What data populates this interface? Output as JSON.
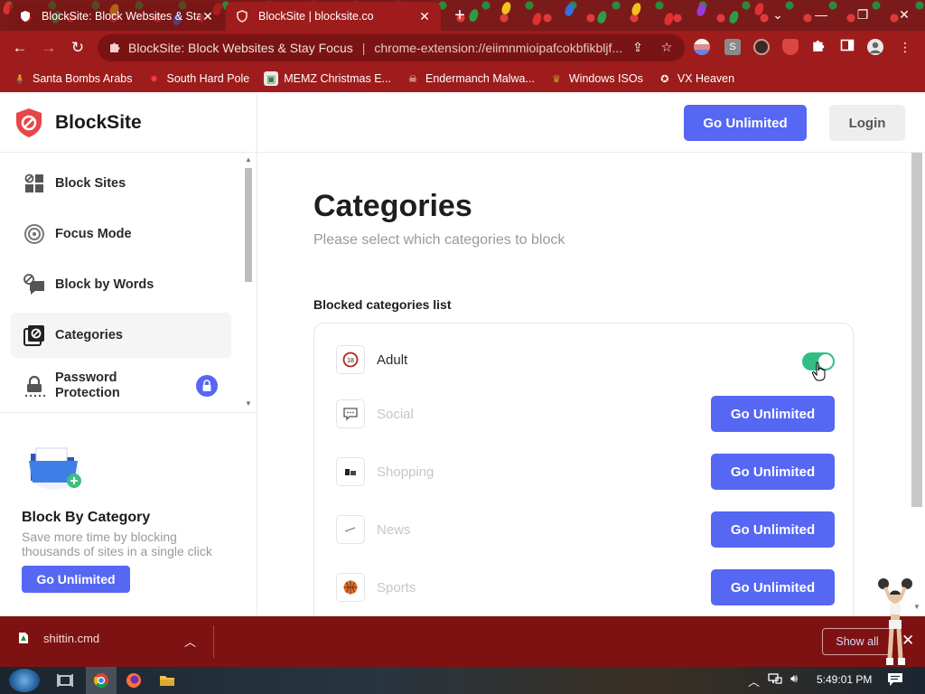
{
  "browser": {
    "tabs": [
      {
        "label": "BlockSite: Block Websites & Stay",
        "active": false
      },
      {
        "label": "BlockSite | blocksite.co",
        "active": true
      }
    ],
    "new_tab": "+",
    "window_controls": {
      "dropdown": "⌄",
      "minimize": "—",
      "restore": "❐",
      "close": "✕"
    },
    "omnibox": {
      "page_name": "BlockSite: Block Websites & Stay Focus",
      "separator": "|",
      "url": "chrome-extension://eiimnmioipafcokbfikbljf..."
    },
    "bookmarks": [
      {
        "label": "Santa Bombs Arabs",
        "icon": "person-icon"
      },
      {
        "label": "South Hard Pole",
        "icon": "maple-leaf-icon"
      },
      {
        "label": "MEMZ Christmas E...",
        "icon": "image-icon"
      },
      {
        "label": "Endermanch Malwa...",
        "icon": "skull-icon"
      },
      {
        "label": "Windows ISOs",
        "icon": "trophy-icon"
      },
      {
        "label": "VX Heaven",
        "icon": "badge-icon"
      }
    ]
  },
  "app": {
    "brand": "BlockSite",
    "header": {
      "go_unlimited": "Go Unlimited",
      "login": "Login"
    },
    "nav": [
      {
        "label": "Block Sites",
        "icon": "grid-icon",
        "active": false
      },
      {
        "label": "Focus Mode",
        "icon": "target-icon",
        "active": false
      },
      {
        "label": "Block by Words",
        "icon": "chat-block-icon",
        "active": false
      },
      {
        "label": "Categories",
        "icon": "categories-icon",
        "active": true
      },
      {
        "label": "Password Protection",
        "icon": "lock-icon",
        "active": false,
        "badge": "lock-badge-icon"
      }
    ],
    "promo": {
      "title": "Block By Category",
      "description": "Save more time by blocking thousands of sites in a single click",
      "button": "Go Unlimited"
    },
    "main": {
      "title": "Categories",
      "subtitle": "Please select which categories to block",
      "list_heading": "Blocked categories list",
      "categories": [
        {
          "label": "Adult",
          "icon": "adult-18-icon",
          "enabled": true,
          "action": "toggle"
        },
        {
          "label": "Social",
          "icon": "chat-bubble-icon",
          "enabled": false,
          "action": "Go Unlimited"
        },
        {
          "label": "Shopping",
          "icon": "shopping-icon",
          "enabled": false,
          "action": "Go Unlimited"
        },
        {
          "label": "News",
          "icon": "news-icon",
          "enabled": false,
          "action": "Go Unlimited"
        },
        {
          "label": "Sports",
          "icon": "basketball-icon",
          "enabled": false,
          "action": "Go Unlimited"
        }
      ]
    }
  },
  "downloads": {
    "file": "shittin.cmd",
    "show_all": "Show all"
  },
  "taskbar": {
    "clock": "5:49:01 PM"
  },
  "colors": {
    "accent": "#5567f3",
    "toggle_on": "#2fbf85",
    "chrome_theme": "#9e1c1c",
    "download_bar": "#7e1212"
  }
}
